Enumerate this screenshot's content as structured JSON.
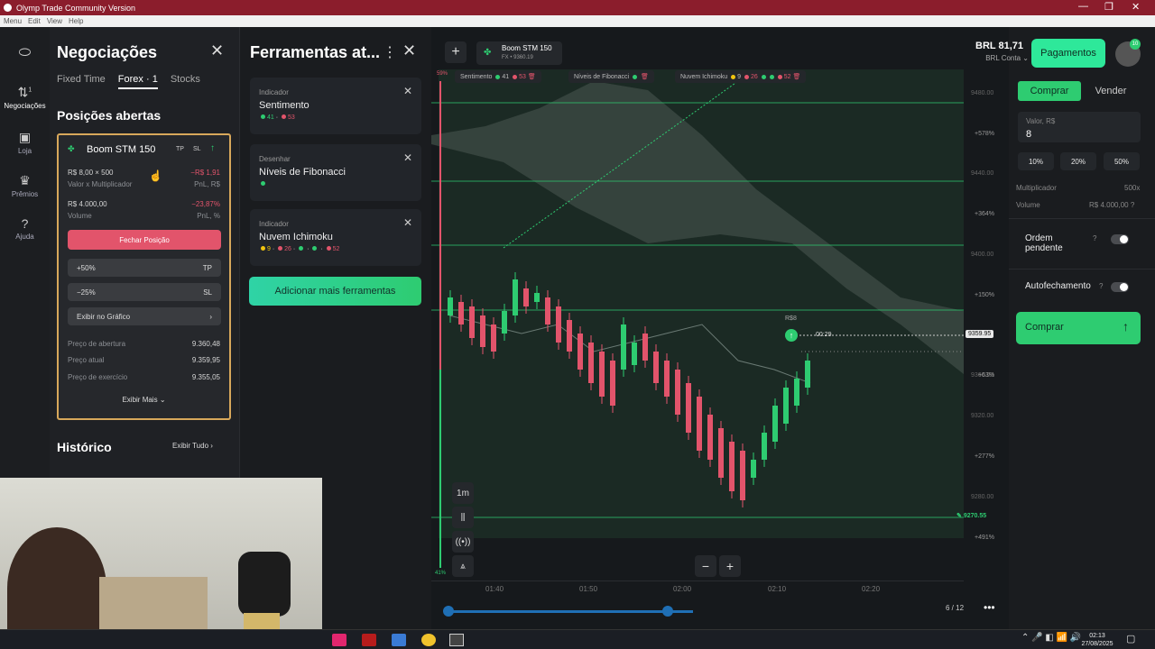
{
  "window": {
    "title": "Olymp Trade Community Version",
    "menu": [
      "Menu",
      "Edit",
      "View",
      "Help"
    ]
  },
  "nav": [
    {
      "label": "Negociações",
      "icon": "swap-arrows-icon",
      "badge": "1"
    },
    {
      "label": "Loja",
      "icon": "shop-icon"
    },
    {
      "label": "Prêmios",
      "icon": "trophy-icon"
    },
    {
      "label": "Ajuda",
      "icon": "help-icon"
    }
  ],
  "trades": {
    "title": "Negociações",
    "tabs": [
      "Fixed Time",
      "Forex · 1",
      "Stocks"
    ],
    "active_tab": "Forex · 1",
    "open_positions_title": "Posições abertas",
    "position": {
      "asset": "Boom STM 150",
      "tp": "TP",
      "sl": "SL",
      "amount": "R$ 8,00 × 500",
      "amount_label": "Valor x Multiplicador",
      "pnl": "−R$ 1,91",
      "pnl_label": "PnL, R$",
      "volume": "R$ 4.000,00",
      "volume_label": "Volume",
      "pnl_pct": "−23,87%",
      "pnl_pct_label": "PnL, %",
      "close_button": "Fechar Posição",
      "take_profit": "+50%",
      "take_profit_tag": "TP",
      "stop_loss": "−25%",
      "stop_loss_tag": "SL",
      "show_chart": "Exibir no Gráfico",
      "open_price_label": "Preço de abertura",
      "open_price": "9.360,48",
      "current_price_label": "Preço atual",
      "current_price": "9.359,95",
      "exercise_price_label": "Preço de exercício",
      "exercise_price": "9.355,05",
      "show_more": "Exibir Mais"
    },
    "history_title": "Histórico",
    "show_all": "Exibir Tudo"
  },
  "tools": {
    "title": "Ferramentas at...",
    "items": [
      {
        "kind": "Indicador",
        "name": "Sentimento",
        "v1": "41",
        "v2": "53"
      },
      {
        "kind": "Desenhar",
        "name": "Níveis de Fibonacci"
      },
      {
        "kind": "Indicador",
        "name": "Nuvem Ichimoku",
        "v1": "9",
        "v2": "26",
        "v3": "52"
      }
    ],
    "add_button": "Adicionar mais ferramentas"
  },
  "chart": {
    "asset": "Boom STM 150",
    "asset_sub": "FX • 9360.19",
    "legend": [
      {
        "name": "Sentimento",
        "v1": "41",
        "v2": "53"
      },
      {
        "name": "Níveis de Fibonacci"
      },
      {
        "name": "Nuvem Ichimoku",
        "v1": "9",
        "v2": "26",
        "v3": "52"
      }
    ],
    "price_ticks": [
      "9480.00",
      "9440.00",
      "9400.00",
      "9360.00",
      "9320.00",
      "9280.00"
    ],
    "pct_ticks": [
      "+578%",
      "+364%",
      "+150%",
      "+63%",
      "+277%",
      "+491%"
    ],
    "time_ticks": [
      "01:40",
      "01:50",
      "02:00",
      "02:10",
      "02:20"
    ],
    "current_price": "9359.95",
    "stop_price": "9270.55",
    "trade_amount": "R$8",
    "timer": "00:29",
    "top_pct": "59%",
    "bottom_pct": "41%",
    "timeframe": "1m",
    "pagination": "6 / 12",
    "more": "•••"
  },
  "account": {
    "balance": "BRL 81,71",
    "account_type": "BRL Conta",
    "payments": "Pagamentos",
    "avatar_badge": "10"
  },
  "order": {
    "buy_tab": "Comprar",
    "sell_tab": "Vender",
    "amount_label": "Valor, R$",
    "amount": "8",
    "presets": [
      "10%",
      "20%",
      "50%"
    ],
    "multiplier_label": "Multiplicador",
    "multiplier": "500x",
    "volume_label": "Volume",
    "volume": "R$ 4.000,00",
    "pending_label": "Ordem pendente",
    "autoclose_label": "Autofechamento",
    "buy_button": "Comprar"
  },
  "taskbar": {
    "time": "02:13",
    "date": "27/08/2025"
  },
  "colors": {
    "accent_green": "#2ecc71",
    "red": "#e2546b",
    "highlight": "#d8a85b",
    "titlebar": "#8b1d2c"
  }
}
